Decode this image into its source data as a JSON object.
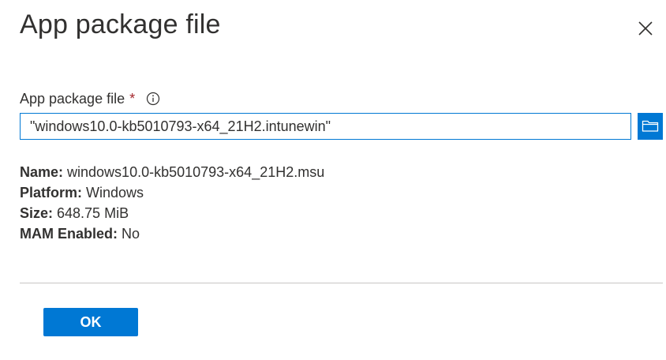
{
  "dialog": {
    "title": "App package file",
    "close_icon": "close-icon"
  },
  "field": {
    "label": "App package file",
    "required_marker": "*",
    "info_icon": "info-icon",
    "value": "\"windows10.0-kb5010793-x64_21H2.intunewin\"",
    "browse_icon": "folder-icon"
  },
  "details": {
    "name_label": "Name:",
    "name_value": "windows10.0-kb5010793-x64_21H2.msu",
    "platform_label": "Platform:",
    "platform_value": "Windows",
    "size_label": "Size:",
    "size_value": "648.75 MiB",
    "mam_label": "MAM Enabled:",
    "mam_value": "No"
  },
  "footer": {
    "ok_label": "OK"
  },
  "colors": {
    "accent": "#0078d4",
    "required": "#a4262c",
    "text": "#323130",
    "divider": "#c8c6c4"
  }
}
